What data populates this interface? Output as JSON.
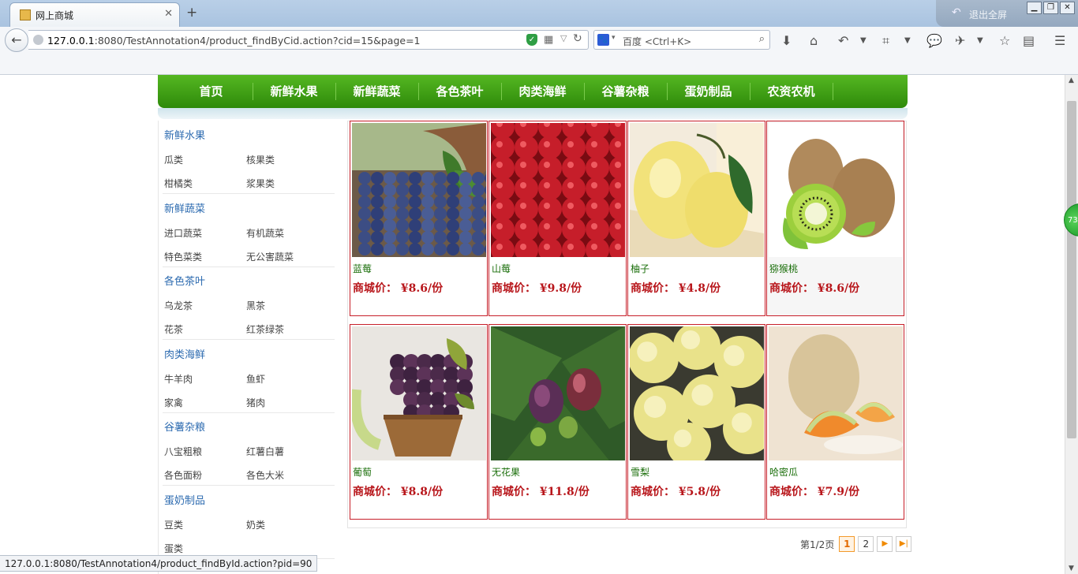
{
  "browser": {
    "tab_title": "网上商城",
    "new_tab": "+",
    "exit_fullscreen": "退出全屏",
    "url_host": "127.0.0.1",
    "url_rest": ":8080/TestAnnotation4/product_findByCid.action?cid=15&page=1",
    "search_placeholder": "百度 <Ctrl+K>",
    "status_text": "127.0.0.1:8080/TestAnnotation4/product_findById.action?pid=90",
    "side_widget": "73"
  },
  "menu": [
    "首页",
    "新鲜水果",
    "新鲜蔬菜",
    "各色茶叶",
    "肉类海鲜",
    "谷薯杂粮",
    "蛋奶制品",
    "农资农机"
  ],
  "sidebar": [
    {
      "title": "新鲜水果",
      "items": [
        "瓜类",
        "核果类",
        "柑橘类",
        "浆果类"
      ]
    },
    {
      "title": "新鲜蔬菜",
      "items": [
        "进口蔬菜",
        "有机蔬菜",
        "特色菜类",
        "无公害蔬菜"
      ]
    },
    {
      "title": "各色茶叶",
      "items": [
        "乌龙茶",
        "黑茶",
        "花茶",
        "红茶绿茶"
      ]
    },
    {
      "title": "肉类海鲜",
      "items": [
        "牛羊肉",
        "鱼虾",
        "家禽",
        "猪肉"
      ]
    },
    {
      "title": "谷薯杂粮",
      "items": [
        "八宝粗粮",
        "红薯白薯",
        "各色面粉",
        "各色大米"
      ]
    },
    {
      "title": "蛋奶制品",
      "items": [
        "豆类",
        "奶类",
        "蛋类"
      ]
    }
  ],
  "products": [
    {
      "name": "蓝莓",
      "price": "商城价： ¥8.6/份",
      "image": "blueberries"
    },
    {
      "name": "山莓",
      "price": "商城价： ¥9.8/份",
      "image": "raspberries"
    },
    {
      "name": "柚子",
      "price": "商城价： ¥4.8/份",
      "image": "pomelo"
    },
    {
      "name": "猕猴桃",
      "price": "商城价： ¥8.6/份",
      "image": "kiwi"
    },
    {
      "name": "葡萄",
      "price": "商城价： ¥8.8/份",
      "image": "grapes"
    },
    {
      "name": "无花果",
      "price": "商城价： ¥11.8/份",
      "image": "figs"
    },
    {
      "name": "雪梨",
      "price": "商城价： ¥5.8/份",
      "image": "pears"
    },
    {
      "name": "哈密瓜",
      "price": "商城价： ¥7.9/份",
      "image": "hami-melon"
    }
  ],
  "pager": {
    "info": "第1/2页",
    "pages": [
      "1",
      "2"
    ],
    "current": "1",
    "next": "▶",
    "last": "▶|"
  }
}
